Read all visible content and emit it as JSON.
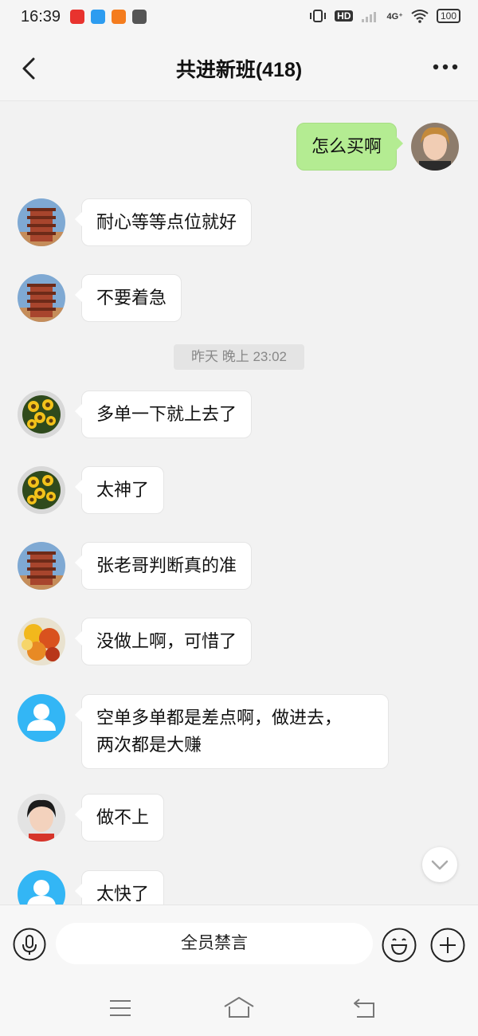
{
  "status_bar": {
    "time": "16:39",
    "hd_label": "HD",
    "network_label": "4G⁺",
    "battery": "100"
  },
  "header": {
    "title": "共进新班(418)",
    "back_icon": "chevron-left-icon",
    "more_icon": "more-horizontal-icon"
  },
  "messages": [
    {
      "sender": "self",
      "avatar": "woman-photo",
      "text": "怎么买啊"
    },
    {
      "sender": "other",
      "avatar": "pagoda",
      "text": "耐心等等点位就好"
    },
    {
      "sender": "other",
      "avatar": "pagoda",
      "text": "不要着急"
    },
    {
      "sender": "other",
      "avatar": "sunflowers",
      "text": "多单一下就上去了"
    },
    {
      "sender": "other",
      "avatar": "sunflowers",
      "text": "太神了"
    },
    {
      "sender": "other",
      "avatar": "pagoda",
      "text": "张老哥判断真的准"
    },
    {
      "sender": "other",
      "avatar": "autumn-leaves",
      "text": "没做上啊，可惜了"
    },
    {
      "sender": "other",
      "avatar": "default-person",
      "text_line1": "空单多单都是差点啊，做进去，",
      "text_line2": "两次都是大赚"
    },
    {
      "sender": "other",
      "avatar": "woman-photo-2",
      "text": "做不上"
    },
    {
      "sender": "other",
      "avatar": "default-person",
      "text": "太快了"
    }
  ],
  "timestamp": "昨天 晚上 23:02",
  "input_bar": {
    "muted_text": "全员禁言",
    "voice_icon": "microphone-icon",
    "emoji_icon": "smiley-icon",
    "plus_icon": "plus-icon"
  },
  "system_nav": {
    "menu_icon": "menu-icon",
    "home_icon": "home-icon",
    "back_icon": "back-icon"
  },
  "colors": {
    "self_bubble": "#b4ec92",
    "other_bubble": "#ffffff",
    "background": "#f2f2f2",
    "default_avatar": "#33b6f5"
  }
}
